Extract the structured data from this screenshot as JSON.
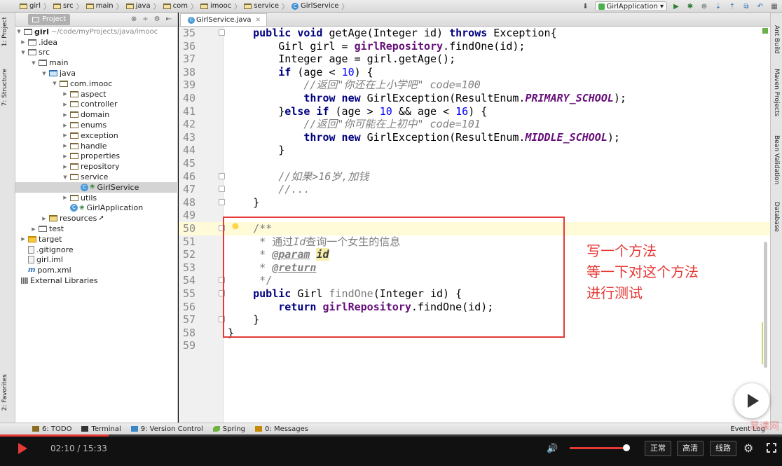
{
  "breadcrumb": [
    "girl",
    "src",
    "main",
    "java",
    "com",
    "imooc",
    "service",
    "GirlService"
  ],
  "toolbar": {
    "run_config": "GirlApplication"
  },
  "left_strip": {
    "project_tab": "1: Project",
    "structure_tab": "7: Structure",
    "favorites_tab": "2: Favorites"
  },
  "right_strip": {
    "ant": "Ant Build",
    "maven": "Maven Projects",
    "bean": "Bean Validation",
    "db": "Database"
  },
  "project_panel": {
    "header": "Project",
    "tree": [
      {
        "label": "girl",
        "extra": "~/code/myProjects/java/imooc"
      },
      {
        "label": ".idea"
      },
      {
        "label": "src"
      },
      {
        "label": "main"
      },
      {
        "label": "java"
      },
      {
        "label": "com.imooc"
      },
      {
        "label": "aspect"
      },
      {
        "label": "controller"
      },
      {
        "label": "domain"
      },
      {
        "label": "enums"
      },
      {
        "label": "exception"
      },
      {
        "label": "handle"
      },
      {
        "label": "properties"
      },
      {
        "label": "repository"
      },
      {
        "label": "service"
      },
      {
        "label": "GirlService"
      },
      {
        "label": "utils"
      },
      {
        "label": "GirlApplication"
      },
      {
        "label": "resources"
      },
      {
        "label": "test"
      },
      {
        "label": "target"
      },
      {
        "label": ".gitignore"
      },
      {
        "label": "girl.iml"
      },
      {
        "label": "pom.xml"
      },
      {
        "label": "External Libraries"
      }
    ]
  },
  "editor": {
    "tab": "GirlService.java",
    "line_numbers": [
      "35",
      "36",
      "37",
      "38",
      "39",
      "40",
      "41",
      "42",
      "43",
      "44",
      "45",
      "46",
      "47",
      "48",
      "49",
      "50",
      "51",
      "52",
      "53",
      "54",
      "55",
      "56",
      "57",
      "58",
      "59"
    ]
  },
  "annotation": [
    "写一个方法",
    "等一下对这个方法",
    "进行测试"
  ],
  "bottom_tools": {
    "todo": "6: TODO",
    "terminal": "Terminal",
    "vc": "9: Version Control",
    "spring": "Spring",
    "messages": "0: Messages",
    "event_log": "Event Log",
    "watermark": "慕课网"
  },
  "player": {
    "time": "02:10 / 15:33",
    "progress": 0.139,
    "volume": 0.93,
    "quality_normal": "正常",
    "quality_hd": "高清",
    "route": "线路"
  },
  "colors": {
    "accent": "#e53935",
    "keyword": "#000080",
    "field": "#660e7a",
    "number": "#0000ff",
    "comment": "#808080"
  }
}
